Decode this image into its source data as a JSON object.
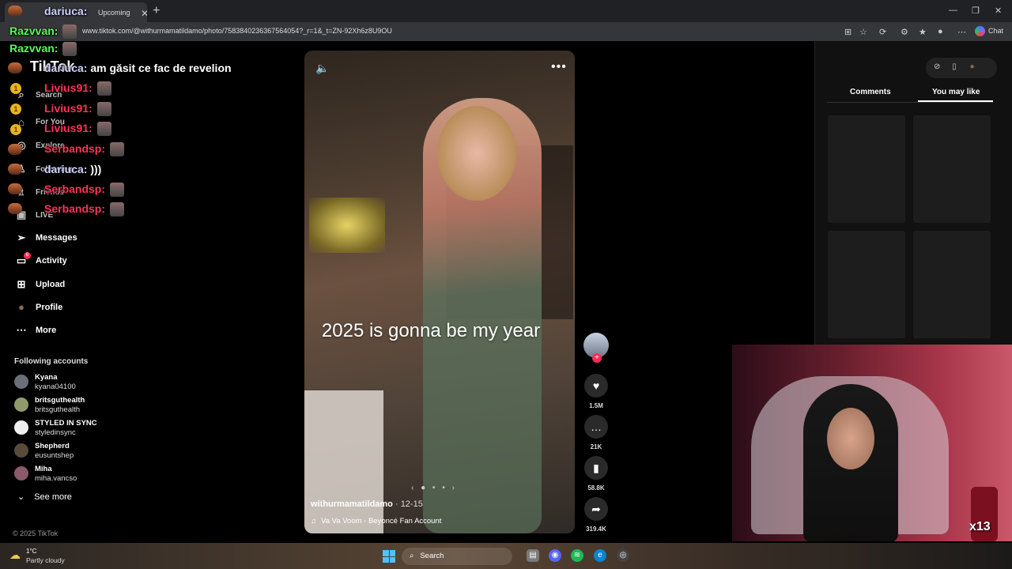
{
  "browser": {
    "tab_title": "Upcoming",
    "url": "www.tiktok.com/@withurmamatildamo/photo/7583840236367564054?_r=1&_t=ZN-92Xh6z8U9OU",
    "chat_label": "Chat"
  },
  "tiktok": {
    "logo": "TikTok",
    "search": "Search",
    "nav": {
      "for_you": "For You",
      "explore": "Explore",
      "following": "Following",
      "friends": "Friends",
      "live": "LIVE",
      "messages": "Messages",
      "activity": "Activity",
      "upload": "Upload",
      "profile": "Profile",
      "more": "More"
    },
    "activity_badge": "6",
    "following_title": "Following accounts",
    "following": [
      {
        "name": "Kyana",
        "user": "kyana04100"
      },
      {
        "name": "britsguthealth",
        "user": "britsguthealth"
      },
      {
        "name": "STYLED IN SYNC",
        "user": "styledinsync"
      },
      {
        "name": "Shepherd",
        "user": "eusuntshep"
      },
      {
        "name": "Miha",
        "user": "miha.vancso"
      }
    ],
    "see_more": "See more",
    "copyright": "© 2025 TikTok"
  },
  "post": {
    "caption": "2025 is gonna be my year",
    "author": "withurmamatildamo",
    "date": "· 12-15",
    "music": "Va Va Voom - Beyoncé Fan Account",
    "likes": "1.5M",
    "comments": "21K",
    "saves": "58.8K",
    "shares": "319.4K"
  },
  "right_panel": {
    "tab_comments": "Comments",
    "tab_you_may_like": "You may like"
  },
  "chat": [
    {
      "user": "dariuca:",
      "text": ""
    },
    {
      "user": "Razvvan:",
      "text": ""
    },
    {
      "user": "Razvvan:",
      "text": ""
    },
    {
      "user": "dariuca:",
      "text": "am găsit ce fac de revelion"
    },
    {
      "user": "Livius91:",
      "text": ""
    },
    {
      "user": "Livius91:",
      "text": ""
    },
    {
      "user": "Livius91:",
      "text": ""
    },
    {
      "user": "Serbandsp:",
      "text": ""
    },
    {
      "user": "dariuca:",
      "text": ")))"
    },
    {
      "user": "Serbandsp:",
      "text": ""
    },
    {
      "user": "Serbandsp:",
      "text": ""
    }
  ],
  "stream": {
    "emote_count": "x13"
  },
  "taskbar": {
    "temp": "1°C",
    "condition": "Partly cloudy",
    "search": "Search"
  },
  "colors": {
    "tiktok_red": "#fe2c55",
    "chat_green": "#55ff55",
    "chat_red": "#ff3355"
  }
}
